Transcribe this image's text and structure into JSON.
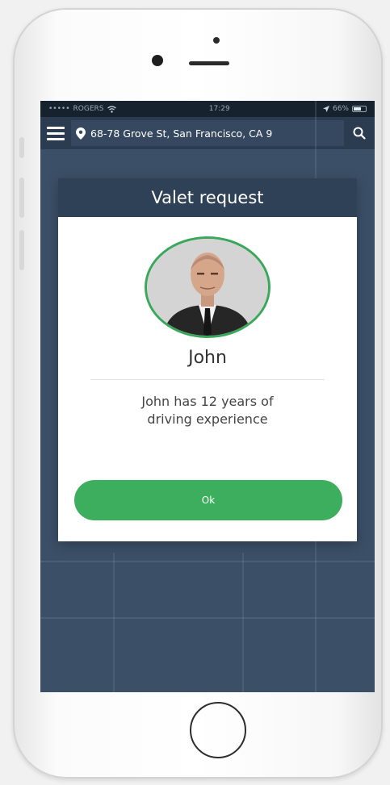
{
  "status_bar": {
    "carrier": "ROGERS",
    "time": "17:29",
    "battery": "66%",
    "battery_level": 0.66
  },
  "navbar": {
    "menu_icon": "hamburger-icon",
    "location_icon": "map-pin-icon",
    "address": "68-78 Grove St, San Francisco, CA 9",
    "search_icon": "search-icon"
  },
  "dialog": {
    "title": "Valet request",
    "driver_name": "John",
    "description_line1": "John has 12 years of",
    "description_line2": "driving experience",
    "ok_label": "Ok"
  },
  "colors": {
    "accent_green": "#3cae5d",
    "header_navy": "#2f4157",
    "map_bg": "#3b4f67"
  }
}
